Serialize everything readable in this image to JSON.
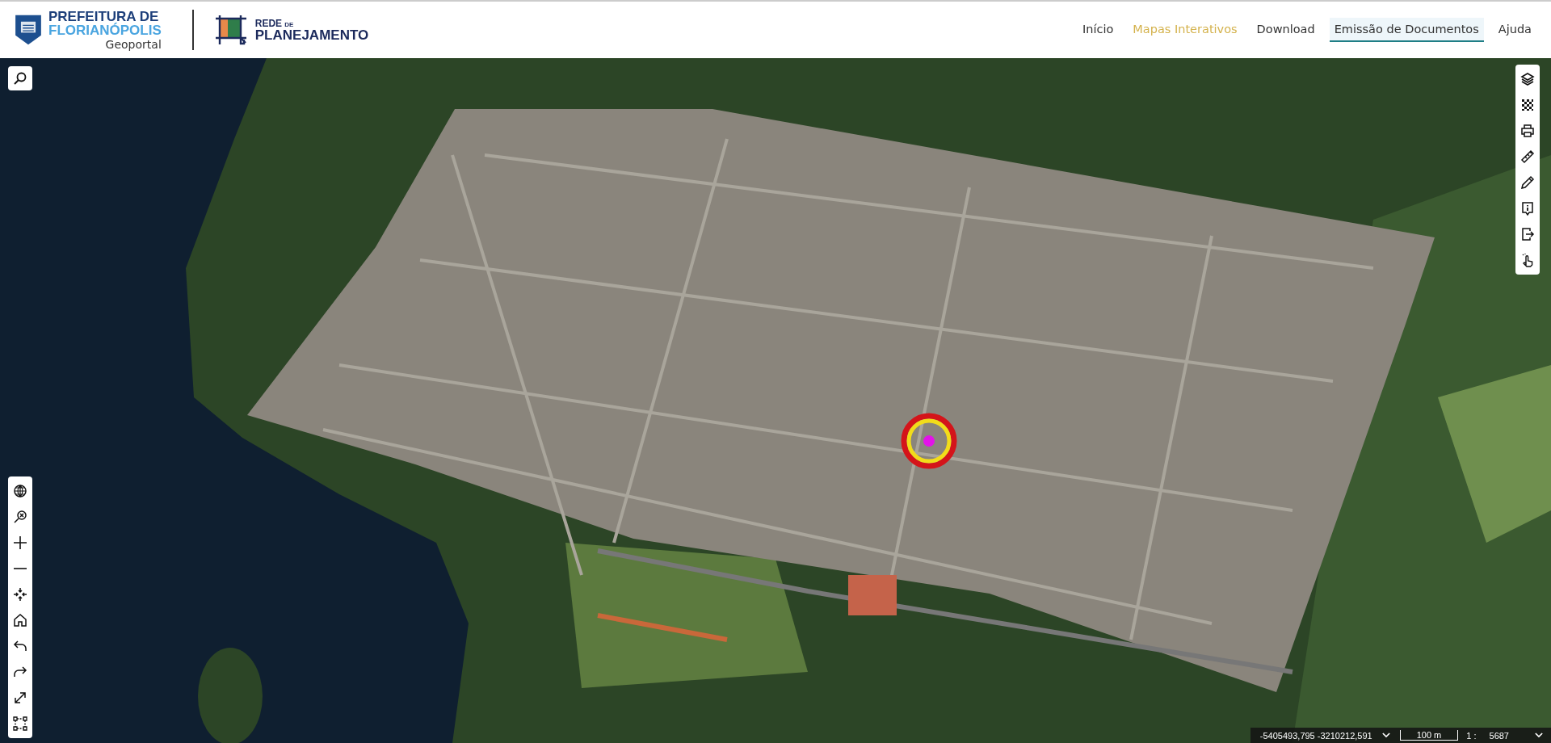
{
  "header": {
    "city_logo": {
      "line_1": "PREFEITURA DE",
      "line_2": "FLORIANÓPOLIS",
      "subtitle": "Geoportal"
    },
    "network_logo": {
      "word_1": "REDE",
      "word_2": "DE",
      "word_3": "PLANEJAMENTO"
    },
    "nav": [
      {
        "label": "Início",
        "selected": false,
        "highlighted": false
      },
      {
        "label": "Mapas Interativos",
        "selected": false,
        "highlighted": true
      },
      {
        "label": "Download",
        "selected": false,
        "highlighted": false
      },
      {
        "label": "Emissão de Documentos",
        "selected": true,
        "highlighted": false
      },
      {
        "label": "Ajuda",
        "selected": false,
        "highlighted": false
      }
    ]
  },
  "status_bar": {
    "coordinates": "-5405493,795 -3210212,591",
    "scale_bar": "100 m",
    "scale_prefix": "1 :",
    "scale_value": "5687"
  }
}
